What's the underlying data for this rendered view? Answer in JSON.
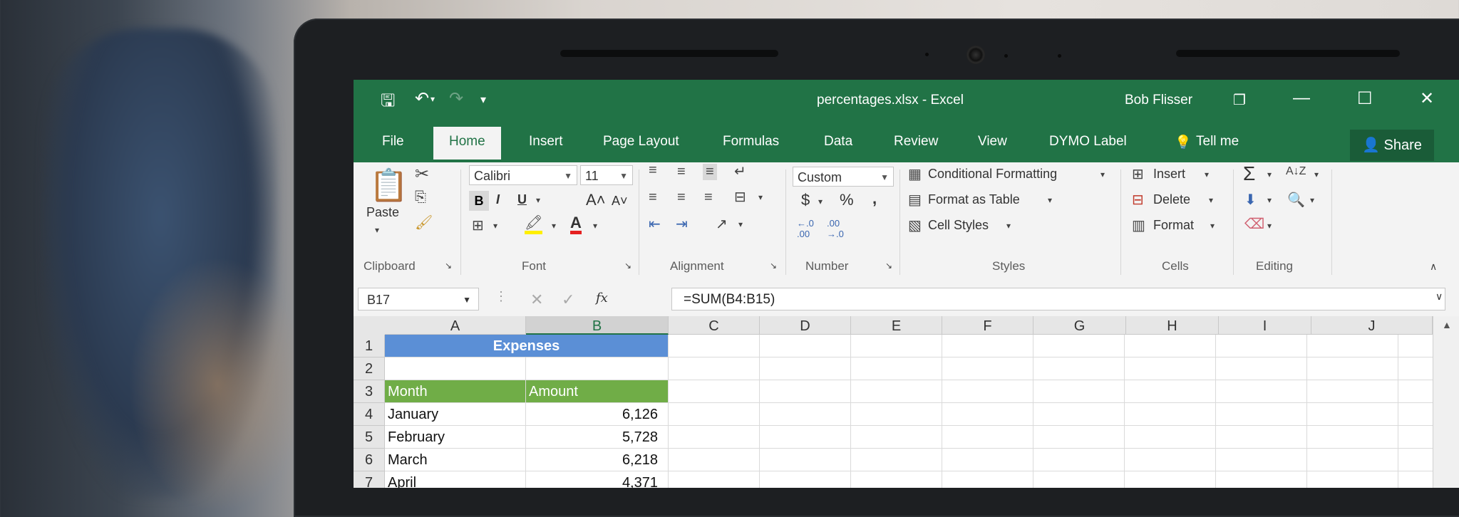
{
  "window": {
    "title": "percentages.xlsx - Excel",
    "user": "Bob Flisser"
  },
  "tabs": [
    "File",
    "Home",
    "Insert",
    "Page Layout",
    "Formulas",
    "Data",
    "Review",
    "View",
    "DYMO Label"
  ],
  "tell_me": "Tell me",
  "share_label": "Share",
  "ribbon": {
    "paste_label": "Paste",
    "font_name": "Calibri",
    "font_size": "11",
    "number_format": "Custom",
    "conditional_formatting": "Conditional Formatting",
    "format_as_table": "Format as Table",
    "cell_styles": "Cell Styles",
    "insert_label": "Insert",
    "delete_label": "Delete",
    "format_label": "Format",
    "groups": {
      "clipboard": "Clipboard",
      "font": "Font",
      "alignment": "Alignment",
      "number": "Number",
      "styles": "Styles",
      "cells": "Cells",
      "editing": "Editing"
    }
  },
  "formula_bar": {
    "name_box": "B17",
    "formula": "=SUM(B4:B15)"
  },
  "columns": [
    "A",
    "B",
    "C",
    "D",
    "E",
    "F",
    "G",
    "H",
    "I",
    "J"
  ],
  "rows": [
    {
      "num": "1",
      "a": "Expenses",
      "b": ""
    },
    {
      "num": "2",
      "a": "",
      "b": ""
    },
    {
      "num": "3",
      "a": "Month",
      "b": "Amount"
    },
    {
      "num": "4",
      "a": "January",
      "b": "6,126"
    },
    {
      "num": "5",
      "a": "February",
      "b": "5,728"
    },
    {
      "num": "6",
      "a": "March",
      "b": "6,218"
    },
    {
      "num": "7",
      "a": "April",
      "b": "4,371"
    }
  ],
  "colors": {
    "excel_green": "#217346",
    "title_fill": "#5b8fd6",
    "header_fill": "#70ad47"
  }
}
